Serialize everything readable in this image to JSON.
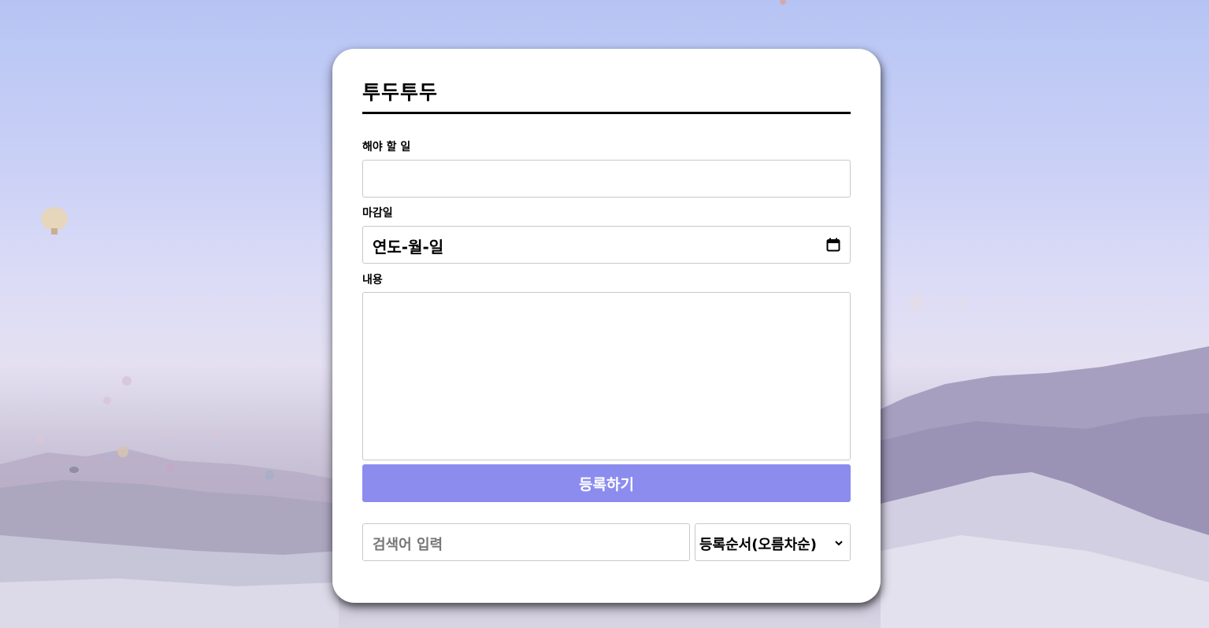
{
  "app": {
    "title": "투두투두"
  },
  "form": {
    "todo_label": "해야 할 일",
    "todo_value": "",
    "deadline_label": "마감일",
    "deadline_placeholder": "연도-월-일",
    "content_label": "내용",
    "content_value": "",
    "submit_label": "등록하기"
  },
  "filter": {
    "search_placeholder": "검색어 입력",
    "sort_selected": "등록순서(오름차순)"
  },
  "icons": {
    "date": "calendar-icon",
    "select": "chevron-down-icon"
  },
  "colors": {
    "accent": "#8c8cef",
    "card": "#ffffff",
    "text": "#000000"
  }
}
